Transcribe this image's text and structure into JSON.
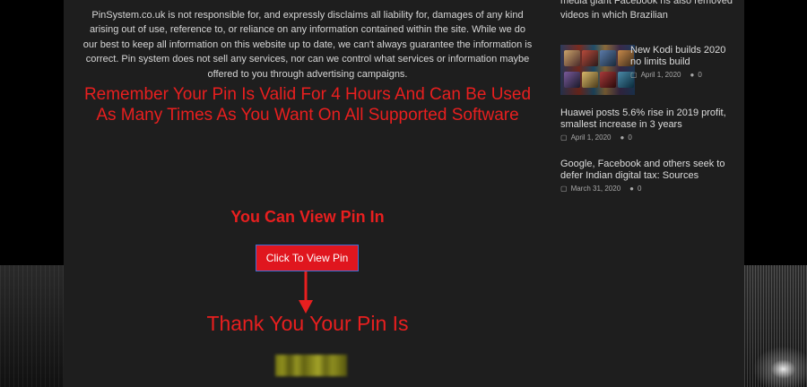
{
  "main": {
    "disclaimer": "PinSystem.co.uk is not responsible for, and expressly disclaims all liability for, damages of any kind arising out of use, reference to, or reliance on any information contained within the site. While we do our best to keep all information on this website up to date, we can't always guarantee the information is correct. Pin system does not sell any services, nor can we control what services or information maybe offered to you through advertising campaigns.",
    "remember": "Remember Your Pin Is Valid For 4 Hours And Can Be Used As Many Times As You Want On All Supported Software",
    "view_in": "You Can View Pin In",
    "button_label": "Click To View Pin",
    "thanks": "Thank You Your Pin Is"
  },
  "sidebar": {
    "top_text": "media giant Facebook hs also removed videos in which Brazilian",
    "posts": [
      {
        "title": "New Kodi builds 2020 no limits build",
        "date": "April 1, 2020",
        "comments": "0"
      },
      {
        "title": "Huawei posts 5.6% rise in 2019 profit, smallest increase in 3 years",
        "date": "April 1, 2020",
        "comments": "0"
      },
      {
        "title": "Google, Facebook and others seek to defer Indian digital tax: Sources",
        "date": "March 31, 2020",
        "comments": "0"
      }
    ]
  },
  "icons": {
    "calendar": "calendar-icon",
    "comment": "comment-icon",
    "arrow": "arrow-down-icon"
  },
  "colors": {
    "accent_red": "#e81f1f",
    "button_bg": "#e0161e",
    "button_border": "#3d6fd6",
    "panel_bg": "#1e1e1e"
  }
}
